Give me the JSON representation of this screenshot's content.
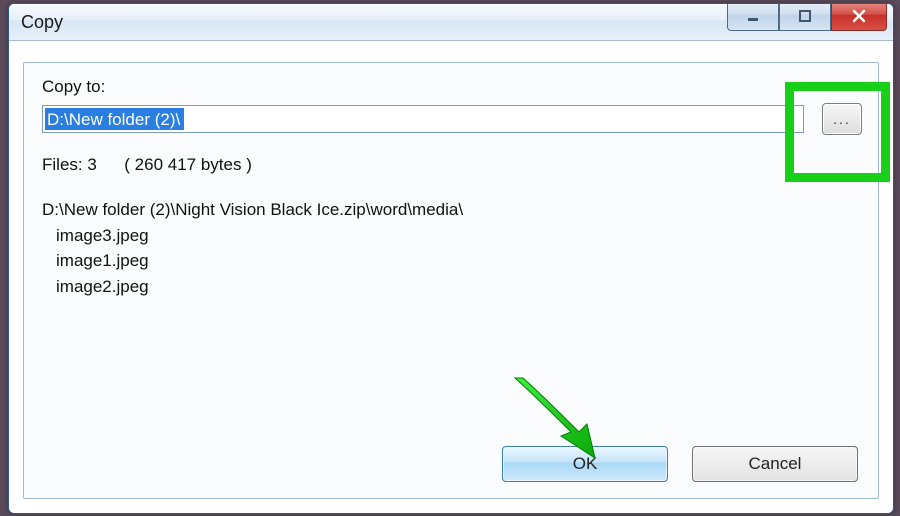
{
  "window": {
    "title": "Copy"
  },
  "form": {
    "copy_to_label": "Copy to:",
    "path_value": "D:\\New folder (2)\\",
    "browse_label": "..."
  },
  "summary": {
    "files_label": "Files:",
    "file_count": "3",
    "size_text": "( 260 417 bytes )"
  },
  "list": {
    "source_path": "D:\\New folder (2)\\Night Vision Black Ice.zip\\word\\media\\",
    "items": [
      "image3.jpeg",
      "image1.jpeg",
      "image2.jpeg"
    ]
  },
  "buttons": {
    "ok": "OK",
    "cancel": "Cancel"
  },
  "highlight_color": "#18d018"
}
